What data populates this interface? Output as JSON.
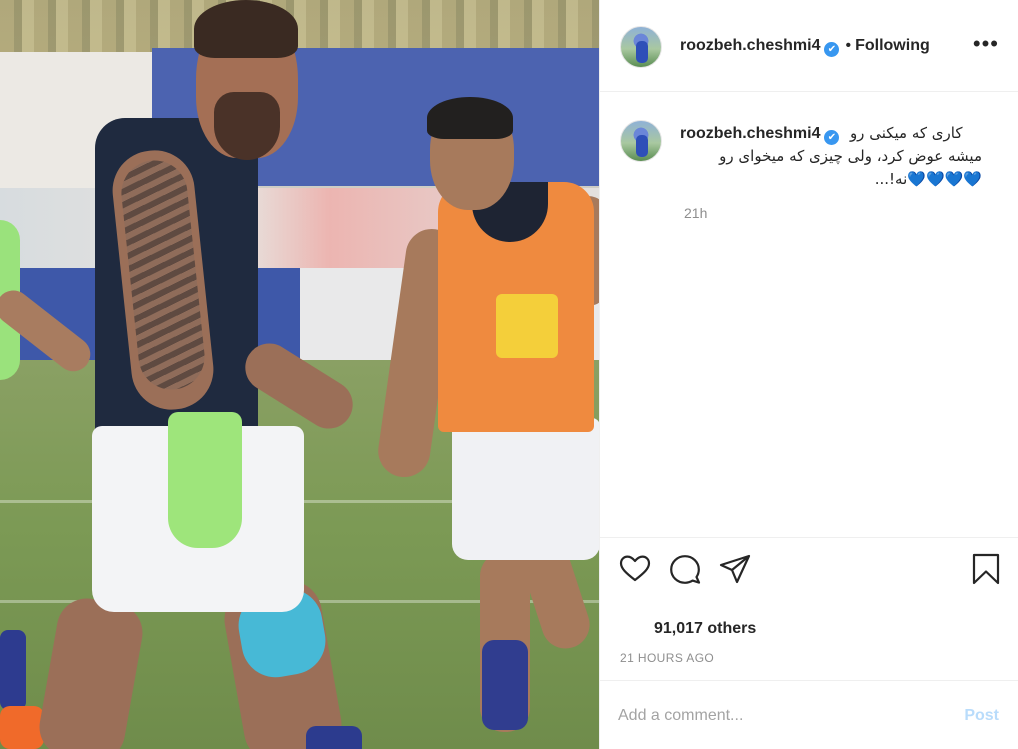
{
  "post": {
    "username": "roozbeh.cheshmi4",
    "verified_symbol": "✔",
    "header_separator": "•",
    "follow_status": "Following",
    "more_symbol": "•••",
    "caption_line1": "کاری که میکنی رو",
    "caption_line2": "میشه عوض کرد، ولی چیزی که میخوای رو",
    "caption_line3": "نه!...",
    "caption_hearts": "💙💙💙💙",
    "caption_time": "21h",
    "likes_text": "91,017 others",
    "posted_time": "21 HOURS AGO"
  },
  "icons": {
    "like": "heart-icon",
    "comment": "comment-bubble-icon",
    "share": "paper-plane-icon",
    "save": "bookmark-icon",
    "more": "ellipsis-icon"
  },
  "comment": {
    "placeholder": "Add a comment...",
    "post_label": "Post"
  },
  "colors": {
    "verified": "#3897f0",
    "post_disabled": "#b9dcfb",
    "hearts": "#1ab3ea"
  }
}
